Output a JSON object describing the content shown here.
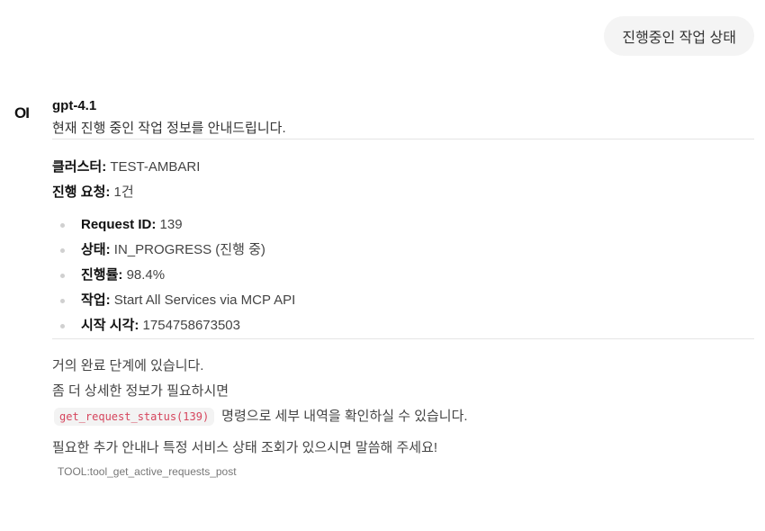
{
  "user_message": "진행중인 작업 상태",
  "assistant": {
    "avatar_text": "OI",
    "model_name": "gpt-4.1",
    "intro": "현재 진행 중인 작업 정보를 안내드립니다.",
    "cluster_label": "클러스터:",
    "cluster_value": "TEST-AMBARI",
    "requests_label": "진행 요청:",
    "requests_value": "1건",
    "details": [
      {
        "label": "Request ID:",
        "value": "139"
      },
      {
        "label": "상태:",
        "value": "IN_PROGRESS (진행 중)"
      },
      {
        "label": "진행률:",
        "value": "98.4%"
      },
      {
        "label": "작업:",
        "value": "Start All Services via MCP API"
      },
      {
        "label": "시작 시각:",
        "value": "1754758673503"
      }
    ],
    "closing_line1": "거의 완료 단계에 있습니다.",
    "closing_line2": "좀 더 상세한 정보가 필요하시면",
    "code_snippet": "get_request_status(139)",
    "closing_line3_suffix": "명령으로 세부 내역을 확인하실 수 있습니다.",
    "final_line": "필요한 추가 안내나 특정 서비스 상태 조회가 있으시면 말씀해 주세요!",
    "tool_label": "TOOL:tool_get_active_requests_post"
  }
}
